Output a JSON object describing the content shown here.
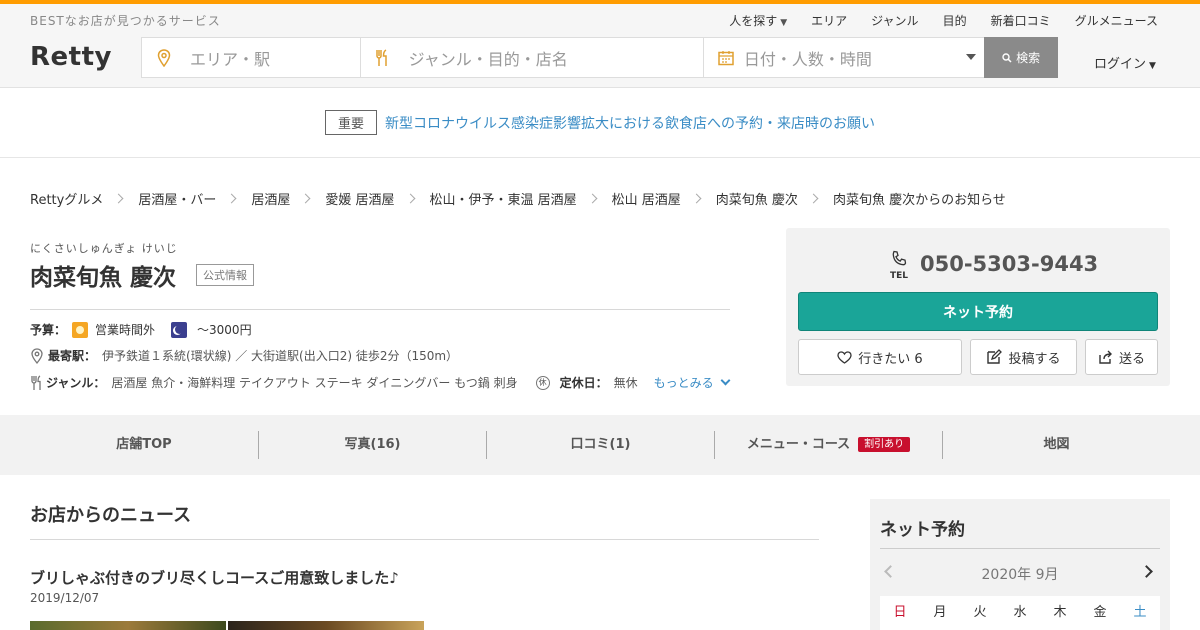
{
  "header": {
    "tagline": "BESTなお店が見つかるサービス",
    "nav": [
      {
        "label": "人を探す",
        "caret": true
      },
      {
        "label": "エリア"
      },
      {
        "label": "ジャンル"
      },
      {
        "label": "目的"
      },
      {
        "label": "新着口コミ"
      },
      {
        "label": "グルメニュース"
      }
    ],
    "logo": "Retty",
    "search": {
      "area_placeholder": "エリア・駅",
      "genre_placeholder": "ジャンル・目的・店名",
      "date_placeholder": "日付・人数・時間",
      "button": "検索"
    },
    "login": "ログイン"
  },
  "notice": {
    "tag": "重要",
    "text": "新型コロナウイルス感染症影響拡大における飲食店への予約・来店時のお願い"
  },
  "breadcrumb": [
    "Rettyグルメ",
    "居酒屋・バー",
    "居酒屋",
    "愛媛 居酒屋",
    "松山・伊予・東温 居酒屋",
    "松山 居酒屋",
    "肉菜旬魚 慶次",
    "肉菜旬魚 慶次からのお知らせ"
  ],
  "shop": {
    "furigana": "にくさいしゅんぎょ けいじ",
    "name": "肉菜旬魚 慶次",
    "official": "公式情報",
    "budget_label": "予算：",
    "budget_day": "営業時間外",
    "budget_night": "～3000円",
    "station_label": "最寄駅：",
    "station": "伊予鉄道１系統(環状線) ／ 大街道駅(出入口2) 徒歩2分（150m）",
    "genre_label": "ジャンル：",
    "genre": "居酒屋 魚介・海鮮料理 テイクアウト ステーキ ダイニングバー もつ鍋 刺身",
    "holiday_icon": "休",
    "holiday_label": "定休日：",
    "holiday": "無休",
    "more": "もっとみる"
  },
  "panel": {
    "tel_icon_label": "TEL",
    "tel": "050-5303-9443",
    "reserve": "ネット予約",
    "want": "行きたい 6",
    "post": "投稿する",
    "send": "送る"
  },
  "tabs": [
    {
      "label": "店舗TOP"
    },
    {
      "label": "写真(16)"
    },
    {
      "label": "口コミ(1)"
    },
    {
      "label": "メニュー・コース",
      "badge": "割引あり"
    },
    {
      "label": "地図"
    }
  ],
  "news": {
    "title": "お店からのニュース",
    "post_title": "ブリしゃぶ付きのブリ尽くしコースご用意致しました♪",
    "post_date": "2019/12/07"
  },
  "calendar": {
    "title": "ネット予約",
    "month": "2020年 9月",
    "weekdays": [
      "日",
      "月",
      "火",
      "水",
      "木",
      "金",
      "土"
    ]
  },
  "colors": {
    "accent": "#ff9c00",
    "reserve": "#1aa598",
    "link": "#3a8cc5",
    "badge": "#c8102e"
  }
}
